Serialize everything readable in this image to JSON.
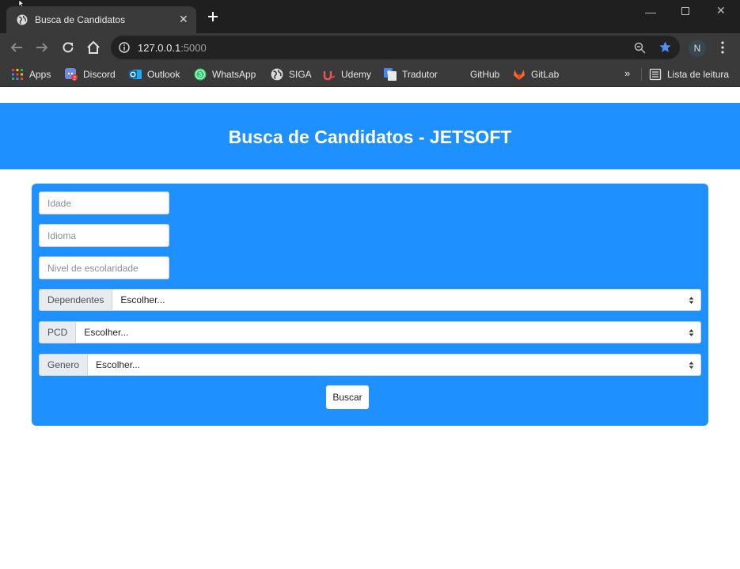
{
  "browser": {
    "tab_title": "Busca de Candidatos",
    "url_host": "127.0.0.1",
    "url_port": ":5000",
    "profile_initial": "N",
    "bookmarks": [
      {
        "label": "Apps",
        "icon": "apps-grid-icon"
      },
      {
        "label": "Discord",
        "icon": "discord-icon",
        "badge": "2"
      },
      {
        "label": "Outlook",
        "icon": "outlook-icon"
      },
      {
        "label": "WhatsApp",
        "icon": "whatsapp-icon",
        "badge": "3"
      },
      {
        "label": "SIGA",
        "icon": "globe-icon"
      },
      {
        "label": "Udemy",
        "icon": "udemy-icon"
      },
      {
        "label": "Tradutor",
        "icon": "translate-icon"
      },
      {
        "label": "GitHub",
        "icon": "github-icon"
      },
      {
        "label": "GitLab",
        "icon": "gitlab-icon"
      }
    ],
    "more_bookmarks": "»",
    "reading_list": "Lista de leitura"
  },
  "page": {
    "header_title": "Busca de Candidatos - JETSOFT",
    "inputs": {
      "idade_placeholder": "Idade",
      "idioma_placeholder": "Idioma",
      "escolaridade_placeholder": "Nivel de escolaridade"
    },
    "selects": {
      "dependentes_label": "Dependentes",
      "dependentes_value": "Escolher...",
      "pcd_label": "PCD",
      "pcd_value": "Escolher...",
      "genero_label": "Genero",
      "genero_value": "Escolher..."
    },
    "search_button": "Buscar"
  },
  "colors": {
    "accent": "#1e90ff",
    "chrome_dark": "#1f1f1f",
    "chrome_toolbar": "#3a3a3a",
    "bookmark_star": "#4f8ff7"
  }
}
